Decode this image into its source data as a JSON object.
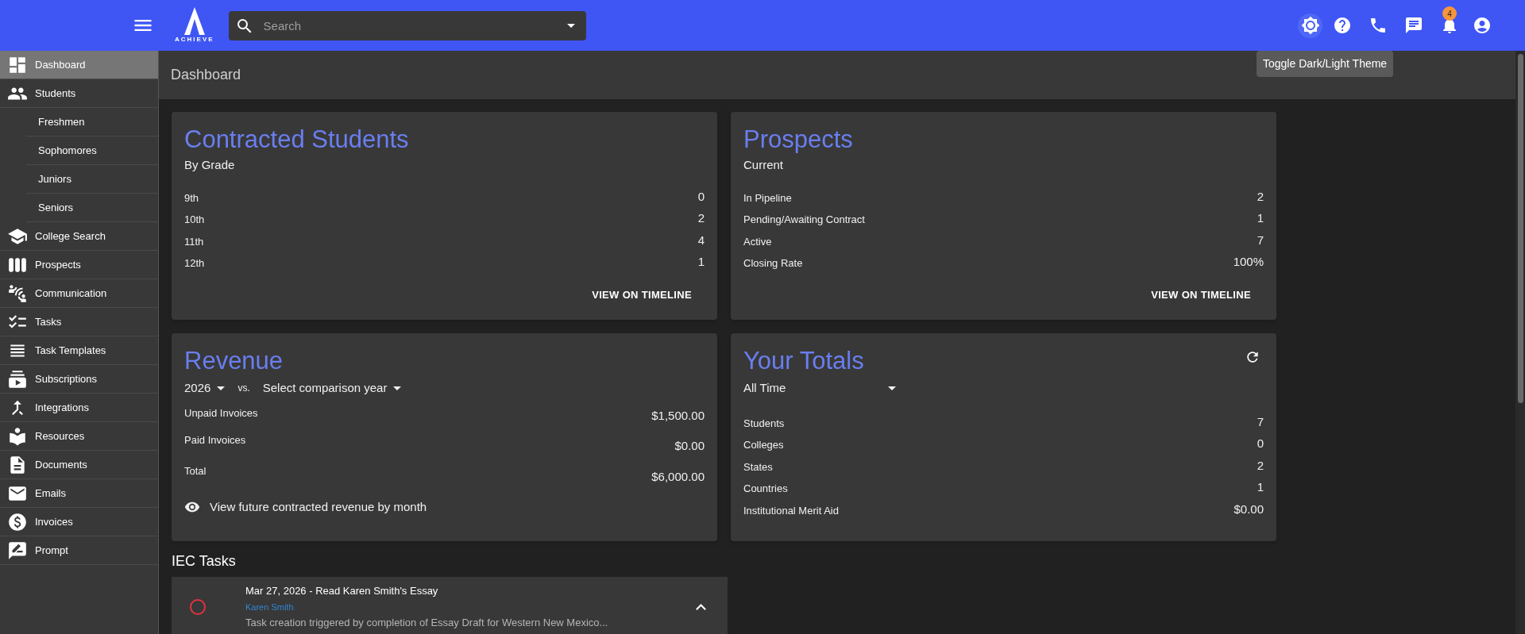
{
  "topbar": {
    "logo_text": "ACHIEVE",
    "search": {
      "placeholder": "Search"
    },
    "notifications_badge": "4",
    "tooltip": "Toggle Dark/Light Theme"
  },
  "sidebar": {
    "items": [
      {
        "label": "Dashboard",
        "selected": true
      },
      {
        "label": "Students",
        "selected": false,
        "children": [
          {
            "label": "Freshmen",
            "selected": false
          },
          {
            "label": "Sophomores",
            "selected": false
          },
          {
            "label": "Juniors",
            "selected": false
          },
          {
            "label": "Seniors",
            "selected": false
          }
        ]
      },
      {
        "label": "College Search",
        "selected": false
      },
      {
        "label": "Prospects",
        "selected": false
      },
      {
        "label": "Communication",
        "selected": false
      },
      {
        "label": "Tasks",
        "selected": false
      },
      {
        "label": "Task Templates",
        "selected": false
      },
      {
        "label": "Subscriptions",
        "selected": false
      },
      {
        "label": "Integrations",
        "selected": false
      },
      {
        "label": "Resources",
        "selected": false
      },
      {
        "label": "Documents",
        "selected": false
      },
      {
        "label": "Emails",
        "selected": false
      },
      {
        "label": "Invoices",
        "selected": false
      },
      {
        "label": "Prompt",
        "selected": false
      }
    ]
  },
  "page_header": {
    "title": "Dashboard"
  },
  "cards": [
    {
      "kind": "stats",
      "title": "Contracted Students",
      "subtitle": "By Grade",
      "rows": [
        {
          "label": "9th",
          "value": "0"
        },
        {
          "label": "10th",
          "value": "2"
        },
        {
          "label": "11th",
          "value": "4"
        },
        {
          "label": "12th",
          "value": "1"
        }
      ],
      "action": "VIEW ON TIMELINE"
    },
    {
      "kind": "stats",
      "title": "Prospects",
      "subtitle": "Current",
      "rows": [
        {
          "label": "In Pipeline",
          "value": "2"
        },
        {
          "label": "Pending/Awaiting Contract",
          "value": "1"
        },
        {
          "label": "Active",
          "value": "7"
        },
        {
          "label": "Closing Rate",
          "value": "100%"
        }
      ],
      "action": "VIEW ON TIMELINE"
    },
    {
      "kind": "revenue",
      "title": "Revenue",
      "year": "2026",
      "vs": "vs.",
      "comparison": "Select comparison year",
      "rows": [
        {
          "label": "Unpaid Invoices",
          "value": "$1,500.00"
        },
        {
          "label": "Paid Invoices",
          "value": "$0.00"
        },
        {
          "label": "Total",
          "value": "$6,000.00"
        }
      ],
      "link": "View future contracted revenue by month"
    },
    {
      "kind": "totals",
      "title": "Your Totals",
      "period": "All Time",
      "rows": [
        {
          "label": "Students",
          "value": "7"
        },
        {
          "label": "Colleges",
          "value": "0"
        },
        {
          "label": "States",
          "value": "2"
        },
        {
          "label": "Countries",
          "value": "1"
        },
        {
          "label": "Institutional Merit Aid",
          "value": "$0.00"
        }
      ]
    }
  ],
  "iec_tasks": {
    "title": "IEC Tasks",
    "items": [
      {
        "title": "Mar 27, 2026 - Read Karen Smith's Essay",
        "student": "Karen Smith",
        "description": "Task creation triggered by completion of Essay Draft for Western New Mexico...",
        "completed": false,
        "expanded": true
      }
    ]
  }
}
